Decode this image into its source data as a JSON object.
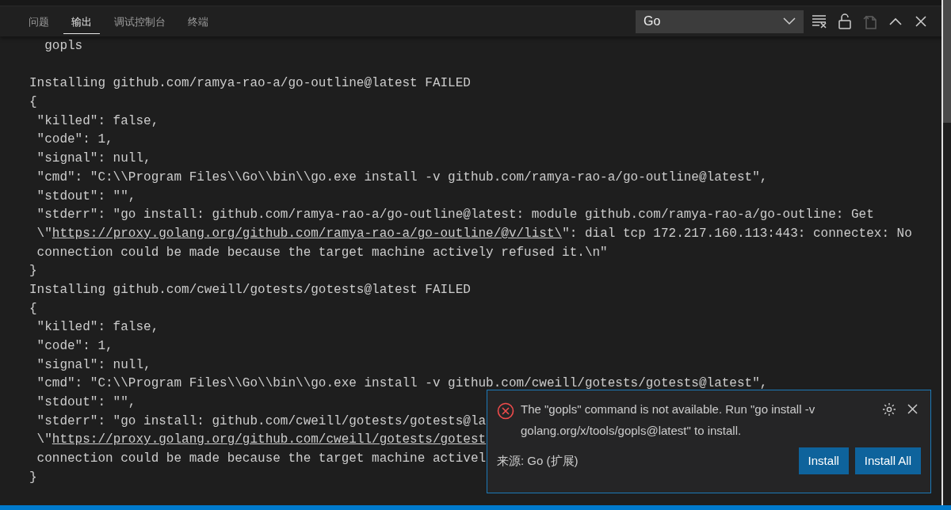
{
  "panel": {
    "tabs": [
      {
        "label": "问题",
        "selected": false
      },
      {
        "label": "输出",
        "selected": true
      },
      {
        "label": "调试控制台",
        "selected": false
      },
      {
        "label": "终端",
        "selected": false
      }
    ],
    "channel_select": {
      "value": "Go"
    },
    "actions": [
      {
        "kind": "clear",
        "disabled": false
      },
      {
        "kind": "lock",
        "disabled": false
      },
      {
        "kind": "copy",
        "disabled": true
      },
      {
        "kind": "maximize",
        "disabled": false
      },
      {
        "kind": "close",
        "disabled": false
      }
    ]
  },
  "output": {
    "lines": [
      {
        "kind": "plain",
        "text": "  gopls"
      },
      {
        "kind": "blank"
      },
      {
        "kind": "plain",
        "text": "Installing github.com/ramya-rao-a/go-outline@latest FAILED"
      },
      {
        "kind": "plain",
        "text": "{"
      },
      {
        "kind": "plain",
        "text": " \"killed\": false,"
      },
      {
        "kind": "plain",
        "text": " \"code\": 1,"
      },
      {
        "kind": "plain",
        "text": " \"signal\": null,"
      },
      {
        "kind": "plain",
        "text": " \"cmd\": \"C:\\\\Program Files\\\\Go\\\\bin\\\\go.exe install -v github.com/ramya-rao-a/go-outline@latest\","
      },
      {
        "kind": "plain",
        "text": " \"stdout\": \"\","
      },
      {
        "kind": "plain",
        "text": " \"stderr\": \"go install: github.com/ramya-rao-a/go-outline@latest: module github.com/ramya-rao-a/go-outline: Get"
      },
      {
        "kind": "link",
        "before": " \\\"",
        "link": "https://proxy.golang.org/github.com/ramya-rao-a/go-outline/@v/list\\",
        "after": "\": dial tcp 172.217.160.113:443: connectex: No"
      },
      {
        "kind": "plain",
        "text": " connection could be made because the target machine actively refused it.\\n\""
      },
      {
        "kind": "plain",
        "text": "}"
      },
      {
        "kind": "plain",
        "text": "Installing github.com/cweill/gotests/gotests@latest FAILED"
      },
      {
        "kind": "plain",
        "text": "{"
      },
      {
        "kind": "plain",
        "text": " \"killed\": false,"
      },
      {
        "kind": "plain",
        "text": " \"code\": 1,"
      },
      {
        "kind": "plain",
        "text": " \"signal\": null,"
      },
      {
        "kind": "plain",
        "text": " \"cmd\": \"C:\\\\Program Files\\\\Go\\\\bin\\\\go.exe install -v github.com/cweill/gotests/gotests@latest\","
      },
      {
        "kind": "plain",
        "text": " \"stdout\": \"\","
      },
      {
        "kind": "plain",
        "text": " \"stderr\": \"go install: github.com/cweill/gotests/gotests@la"
      },
      {
        "kind": "link",
        "before": " \\\"",
        "link": "https://proxy.golang.org/github.com/cweill/gotests/gotest"
      },
      {
        "kind": "plain",
        "text": " connection could be made because the target machine activel"
      },
      {
        "kind": "plain",
        "text": "}"
      }
    ]
  },
  "notification": {
    "message": "The \"gopls\" command is not available. Run \"go install -v golang.org/x/tools/gopls@latest\" to install.",
    "source": "来源: Go (扩展)",
    "buttons": [
      "Install",
      "Install All"
    ]
  }
}
